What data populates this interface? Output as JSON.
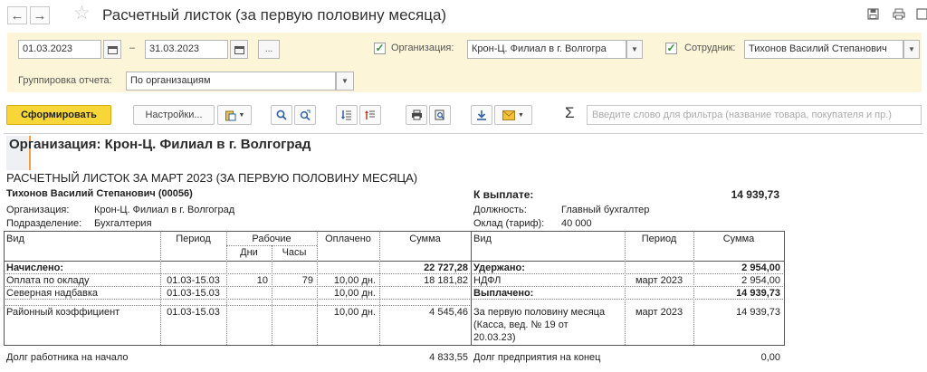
{
  "titlebar": {
    "back_icon": "←",
    "forward_icon": "→",
    "title": "Расчетный листок (за первую половину месяца)"
  },
  "filters": {
    "date_from": "01.03.2023",
    "date_sep": "–",
    "date_to": "31.03.2023",
    "more_label": "...",
    "org_label": "Организация:",
    "org_value": "Крон-Ц. Филиал в г. Волгогра",
    "org_checked": true,
    "employee_label": "Сотрудник:",
    "employee_value": "Тихонов Василий Степанович",
    "employee_checked": true,
    "grouping_label": "Группировка отчета:",
    "grouping_value": "По организациям"
  },
  "toolbar": {
    "generate_label": "Сформировать",
    "settings_label": "Настройки...",
    "filter_placeholder": "Введите слово для фильтра (название товара, покупателя и пр.)",
    "sigma": "Σ"
  },
  "report": {
    "org_heading": "Организация: Крон-Ц. Филиал в г. Волгоград",
    "title": "РАСЧЕТНЫЙ ЛИСТОК ЗА МАРТ 2023 (ЗА ПЕРВУЮ ПОЛОВИНУ МЕСЯЦА)",
    "employee": "Тихонов Василий Степанович (00056)",
    "org_label": "Организация:",
    "org_value": "Крон-Ц. Филиал в г. Волгоград",
    "dept_label": "Подразделение:",
    "dept_value": "Бухгалтерия",
    "to_pay_label": "К выплате:",
    "to_pay_value": "14 939,73",
    "position_label": "Должность:",
    "position_value": "Главный бухгалтер",
    "salary_label": "Оклад (тариф):",
    "salary_value": "40 000",
    "cols_left": {
      "kind": "Вид",
      "period": "Период",
      "work": "Рабочие",
      "days": "Дни",
      "hours": "Часы",
      "paid": "Оплачено",
      "sum": "Сумма"
    },
    "cols_right": {
      "kind": "Вид",
      "period": "Период",
      "sum": "Сумма"
    },
    "accrued_label": "Начислено:",
    "accrued_total": "22 727,28",
    "accruals": [
      {
        "kind": "Оплата по окладу",
        "period": "01.03-15.03",
        "days": "10",
        "hours": "79",
        "paid": "10,00 дн.",
        "sum": "18 181,82"
      },
      {
        "kind": "Северная надбавка",
        "period": "01.03-15.03",
        "days": "",
        "hours": "",
        "paid": "10,00 дн.",
        "sum": ""
      },
      {
        "kind": "Районный коэффициент",
        "period": "01.03-15.03",
        "days": "",
        "hours": "",
        "paid": "10,00 дн.",
        "sum": "4 545,46"
      }
    ],
    "withheld_label": "Удержано:",
    "withheld_total": "2 954,00",
    "withholdings": [
      {
        "kind": "НДФЛ",
        "period": "март 2023",
        "sum": "2 954,00"
      }
    ],
    "paid_label": "Выплачено:",
    "paid_total": "14 939,73",
    "payments": [
      {
        "kind_1": "За первую половину месяца",
        "kind_2": "(Касса, вед. № 19 от",
        "kind_3": "20.03.23)",
        "period": "март 2023",
        "sum": "14 939,73"
      }
    ],
    "debt_start_label": "Долг работника на начало",
    "debt_start_value": "4 833,55",
    "debt_end_label": "Долг предприятия на конец",
    "debt_end_value": "0,00"
  }
}
